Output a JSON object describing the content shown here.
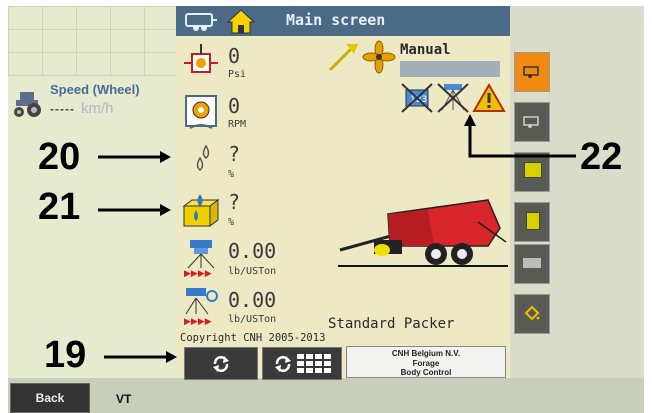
{
  "left": {
    "speed_label": "Speed (Wheel)",
    "speed_dashes": "-----",
    "speed_unit": "km/h"
  },
  "header": {
    "title": "Main screen"
  },
  "params": [
    {
      "value": "0",
      "unit": "Psi",
      "icon": "pressure-icon"
    },
    {
      "value": "0",
      "unit": "RPM",
      "icon": "rpm-gear-icon"
    },
    {
      "value": "?",
      "unit": "%",
      "icon": "moisture-drops-icon"
    },
    {
      "value": "?",
      "unit": "%",
      "icon": "bale-moisture-icon"
    },
    {
      "value": "0.00",
      "unit": "lb/USTon",
      "icon": "preservative-rate-icon"
    },
    {
      "value": "0.00",
      "unit": "lb/USTon",
      "icon": "preservative-rate-2-icon"
    }
  ],
  "mode": {
    "label": "Manual"
  },
  "copyright": "Copyright CNH 2005-2013",
  "machine": "Standard Packer",
  "cnh": {
    "line1": "CNH Belgium N.V.",
    "line2": "Forage",
    "line3": "Body Control"
  },
  "bottom": {
    "back": "Back",
    "vt": "VT"
  },
  "callouts": {
    "c19": "19",
    "c20": "20",
    "c21": "21",
    "c22": "22"
  },
  "colors": {
    "title_bar": "#4a6a86",
    "panel": "#ede9c5",
    "active_softkey": "#f08a10",
    "baler_red": "#d8262a"
  }
}
